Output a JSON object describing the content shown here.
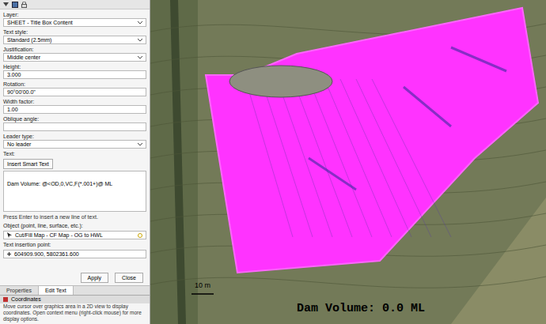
{
  "panel": {
    "fields": [
      {
        "label": "Layer:",
        "value": "SHEET - Title Box Content",
        "kind": "dropdown"
      },
      {
        "label": "Text style:",
        "value": "Standard (2.5mm)",
        "kind": "dropdown"
      },
      {
        "label": "Justification:",
        "value": "Middle center",
        "kind": "dropdown"
      },
      {
        "label": "Height:",
        "value": "3.000",
        "kind": "input"
      },
      {
        "label": "Rotation:",
        "value": "90°00'00.0\"",
        "kind": "input"
      },
      {
        "label": "Width factor:",
        "value": "1.00",
        "kind": "input"
      },
      {
        "label": "Oblique angle:",
        "value": "",
        "kind": "input"
      },
      {
        "label": "Leader type:",
        "value": "No leader",
        "kind": "dropdown"
      }
    ],
    "text_label": "Text:",
    "smart_button": "Insert Smart Text",
    "text_value": "Dam Volume: @<OD,0,VC,F(*.001+)@ ML",
    "hint": "Press Enter to insert a new line of text.",
    "object_label": "Object (point, line, surface, etc.):",
    "object_value": "Cut/Fill Map - CF Map - OG to HWL",
    "point_label": "Text insertion point:",
    "point_value": "604909.900, 5802361.600",
    "buttons": [
      "Apply",
      "Close"
    ]
  },
  "tabs": [
    {
      "label": "Properties",
      "selected": false
    },
    {
      "label": "Edit Text",
      "selected": true
    }
  ],
  "coordinates": {
    "title": "Coordinates",
    "text": "Move cursor over graphics area in a 2D view to display coordinates. Open context menu (right-click mouse) for more display options."
  },
  "map": {
    "scale": "10 m",
    "label": "Dam Volume: 0.0 ML"
  }
}
